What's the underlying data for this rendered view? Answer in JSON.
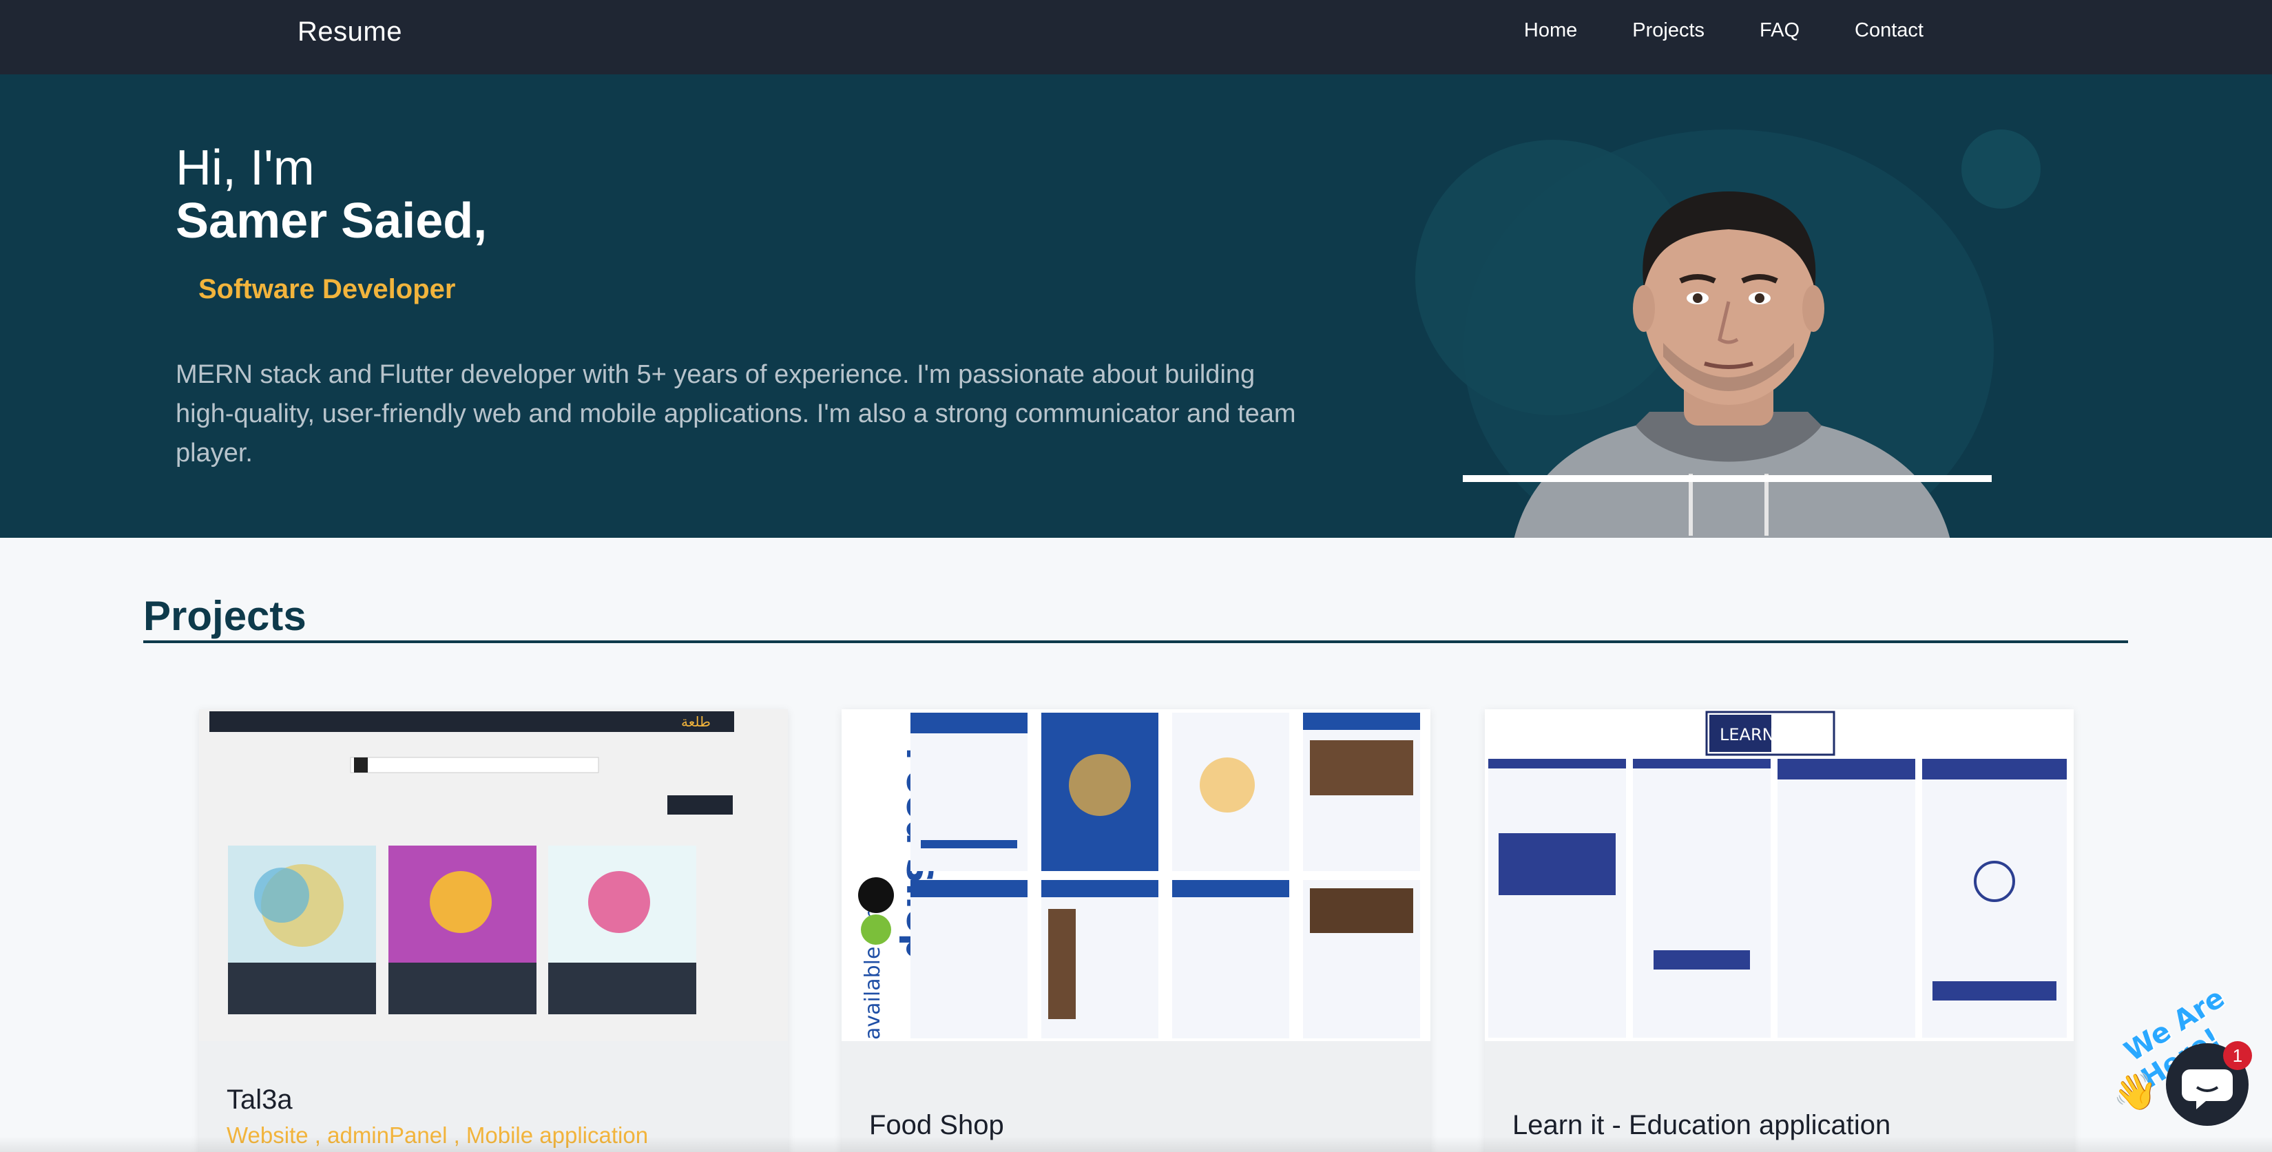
{
  "navbar": {
    "brand": "Resume",
    "links": [
      "Home",
      "Projects",
      "FAQ",
      "Contact"
    ]
  },
  "hero": {
    "greeting": "Hi, I'm",
    "name": "Samer Saied,",
    "role": "Software Developer",
    "bio": "MERN stack and Flutter developer with 5+ years of experience. I'm passionate about building high-quality, user-friendly web and mobile applications. I'm also a strong communicator and team player."
  },
  "projects": {
    "heading": "Projects",
    "items": [
      {
        "title": "Tal3a",
        "tags": "Website , adminPanel , Mobile application",
        "thumb_text": "طلعة"
      },
      {
        "title": "Food Shop",
        "tags": "",
        "thumb_text": "Food Shop",
        "thumb_side": "available for"
      },
      {
        "title": "Learn it - Education application",
        "tags": "",
        "thumb_text": "LEARN IT"
      }
    ]
  },
  "chat": {
    "label": "We Are Here!",
    "badge_count": "1"
  },
  "colors": {
    "nav_bg": "#1f2633",
    "hero_bg": "#0e3a4b",
    "accent": "#f2b43c",
    "page_bg": "#f6f8fa"
  }
}
